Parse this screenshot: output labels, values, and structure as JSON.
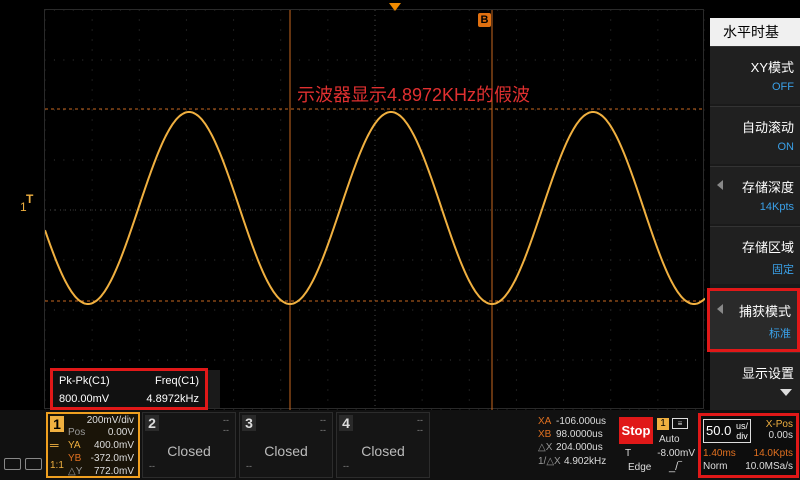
{
  "annotation": "示波器显示4.8972KHz的假波",
  "markers": {
    "b_label": "B",
    "ch1_level_label": "1",
    "trigger_level_label": "T"
  },
  "waveform": {
    "color": "#f0b040",
    "cycles_visible": 3.25
  },
  "measurements": {
    "headers": [
      "Pk-Pk(C1)",
      "Freq(C1)"
    ],
    "values": [
      "800.00mV",
      "4.8972kHz"
    ]
  },
  "menu": {
    "title": "水平时基",
    "items": [
      {
        "label": "XY模式",
        "value": "OFF",
        "arrow": false
      },
      {
        "label": "自动滚动",
        "value": "ON",
        "arrow": false
      },
      {
        "label": "存储深度",
        "value": "14Kpts",
        "arrow": true
      },
      {
        "label": "存储区域",
        "value": "固定",
        "arrow": false
      },
      {
        "label": "捕获模式",
        "value": "标准",
        "arrow": true
      },
      {
        "label": "显示设置",
        "value": "",
        "arrow": false
      }
    ]
  },
  "channels": {
    "ch1": {
      "number": "1",
      "scale": "200mV/div",
      "pos_label": "Pos",
      "pos_value": "0.00V",
      "ya_label": "YA",
      "ya_value": "400.0mV",
      "yb_label": "YB",
      "yb_value": "-372.0mV",
      "coupling": "1:1",
      "dy_label": "△Y",
      "dy_value": "772.0mV"
    },
    "others": [
      {
        "number": "2",
        "status": "Closed",
        "dash": "--"
      },
      {
        "number": "3",
        "status": "Closed",
        "dash": "--"
      },
      {
        "number": "4",
        "status": "Closed",
        "dash": "--"
      }
    ]
  },
  "cursors": {
    "xa_label": "XA",
    "xa_value": "-106.000us",
    "xb_label": "XB",
    "xb_value": "98.0000us",
    "dx_label": "△X",
    "dx_value": "204.000us",
    "inv_label": "1/△X",
    "inv_value": "4.902kHz"
  },
  "run": {
    "stop_label": "Stop",
    "trig_channel": "1",
    "trig_mode": "Auto",
    "trig_level_label": "T",
    "trig_level_value": "-8.00mV",
    "trig_type": "Edge"
  },
  "timebase": {
    "scale_value": "50.0",
    "scale_unit_top": "us/",
    "scale_unit_bottom": "div",
    "xpos_label": "X-Pos",
    "xpos_value": "0.00s",
    "record_time": "1.40ms",
    "depth": "14.0Kpts",
    "acq_mode": "Norm",
    "sample_rate": "10.0MSa/s"
  }
}
